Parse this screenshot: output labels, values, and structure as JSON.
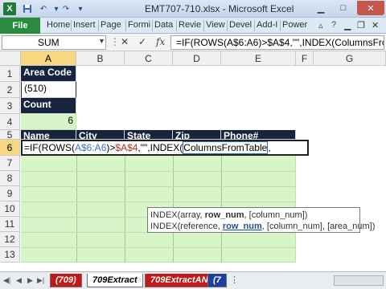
{
  "window": {
    "title": "EMT707-710.xlsx - Microsoft Excel",
    "app_icon": "X",
    "quick_access": [
      "save-icon",
      "undo-icon",
      "redo-icon",
      "customize-icon"
    ],
    "controls": [
      "minimize-icon",
      "maximize-icon",
      "close-icon"
    ]
  },
  "ribbon": {
    "file_label": "File",
    "tabs": [
      "Home",
      "Insert",
      "Page",
      "Formi",
      "Data",
      "Revie",
      "View",
      "Devel",
      "Add-I",
      "Power"
    ]
  },
  "formula_bar": {
    "name_box": "SUM",
    "cancel_glyph": "✕",
    "enter_glyph": "✓",
    "fx_label": "fx",
    "formula": "=IF(ROWS(A$6:A6)>$A$4,\"\",INDEX(ColumnsFromTable,"
  },
  "grid": {
    "columns": [
      "A",
      "B",
      "C",
      "D",
      "E",
      "F",
      "G"
    ],
    "rows": [
      "1",
      "2",
      "3",
      "4",
      "5",
      "6",
      "7",
      "8",
      "9",
      "10",
      "11",
      "12",
      "13"
    ],
    "cells": {
      "a1": "Area Code",
      "a2": "(510)",
      "a3": "Count",
      "a4": "6",
      "a5": "Name",
      "b5": "City",
      "c5": "State",
      "d5": "Zip",
      "e5": "Phone#"
    },
    "edit_parts": {
      "p1": "=IF(ROWS(",
      "p2": "A$6:A6",
      "p3": ")>",
      "p4": "$A$4",
      "p5": ",\"\",INDEX(",
      "p6": "ColumnsFromTable",
      "p7": ","
    },
    "tooltip": {
      "line1_pre": "INDEX(array, ",
      "line1_bold": "row_num",
      "line1_post": ", [column_num])",
      "line2_pre": "INDEX(reference, ",
      "line2_link": "row_num",
      "line2_post": ", [column_num], [area_num])"
    }
  },
  "sheet_tabs": {
    "tabs": [
      "(709)",
      "709Extract",
      "709ExtractAN",
      "(7"
    ],
    "active": "709Extract"
  },
  "colors": {
    "header_fill": "#16243e",
    "green_fill": "#d8f5c9",
    "tab_red": "#c41818",
    "tab_blue": "#1f3fa0",
    "excel_green": "#2a8a3e"
  }
}
